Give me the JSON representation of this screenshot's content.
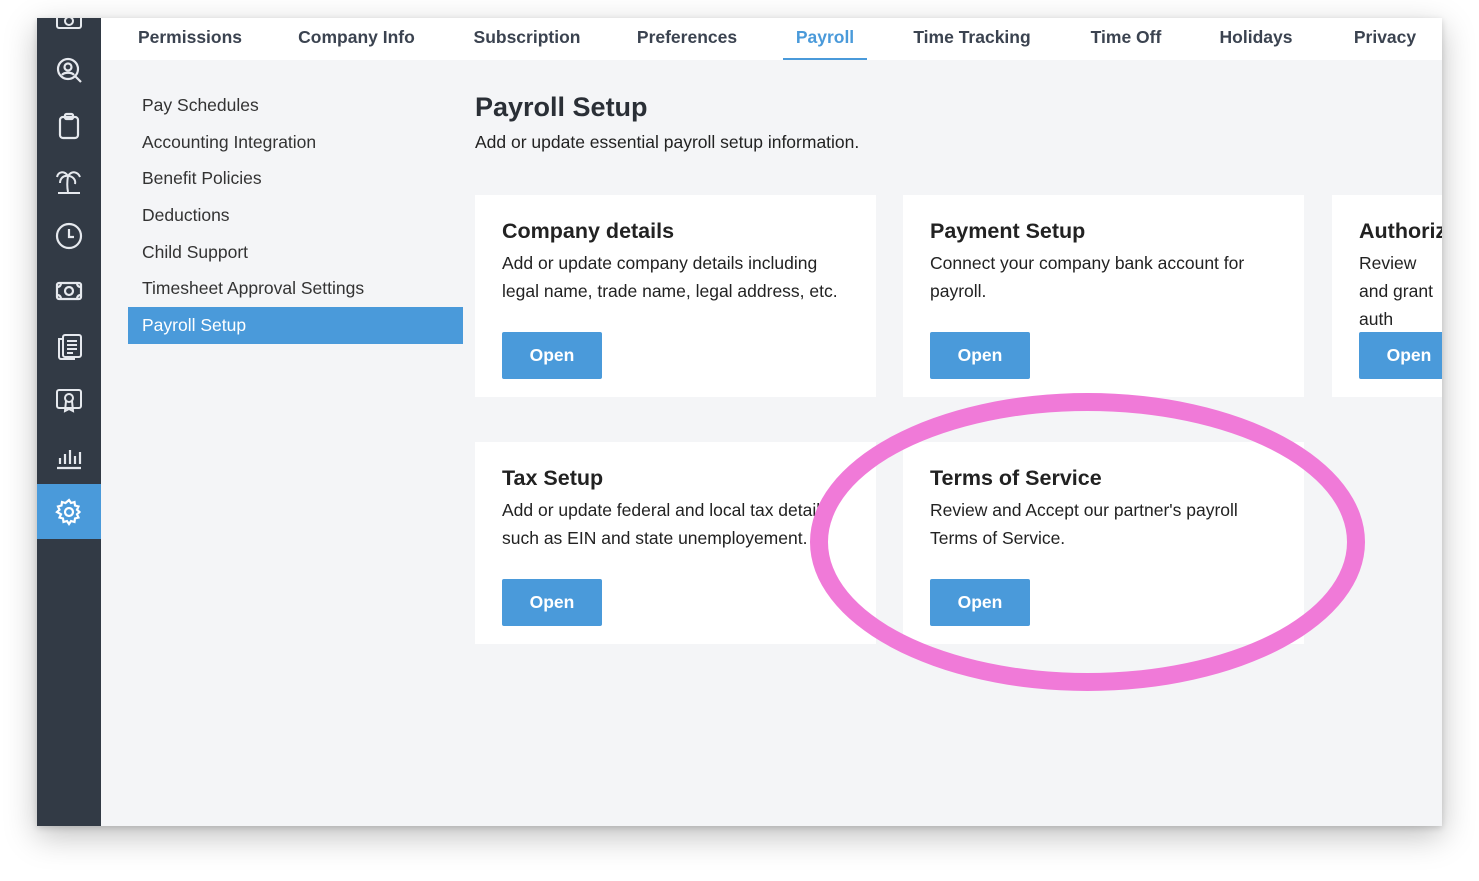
{
  "colors": {
    "accent": "#4a9ada",
    "rail": "#323a45",
    "highlight": "#f07ad8"
  },
  "rail": {
    "icons": [
      "money-icon",
      "user-search-icon",
      "clipboard-icon",
      "palm-tree-icon",
      "clock-icon",
      "cash-icon",
      "documents-icon",
      "certificate-icon",
      "bar-chart-icon",
      "gear-icon"
    ],
    "active": "gear-icon"
  },
  "tabs": [
    {
      "label": "Permissions"
    },
    {
      "label": "Company Info"
    },
    {
      "label": "Subscription"
    },
    {
      "label": "Preferences"
    },
    {
      "label": "Payroll",
      "active": true
    },
    {
      "label": "Time Tracking"
    },
    {
      "label": "Time Off"
    },
    {
      "label": "Holidays"
    },
    {
      "label": "Privacy"
    }
  ],
  "subnav": [
    {
      "label": "Pay Schedules"
    },
    {
      "label": "Accounting Integration"
    },
    {
      "label": "Benefit Policies"
    },
    {
      "label": "Deductions"
    },
    {
      "label": "Child Support"
    },
    {
      "label": "Timesheet Approval Settings"
    },
    {
      "label": "Payroll Setup",
      "active": true
    }
  ],
  "page": {
    "title": "Payroll Setup",
    "subtitle": "Add or update essential payroll setup information."
  },
  "cards": [
    {
      "title": "Company details",
      "desc": "Add or update company details including legal name, trade name, legal address, etc.",
      "button": "Open"
    },
    {
      "title": "Payment Setup",
      "desc": "Connect your company bank account for payroll.",
      "button": "Open"
    },
    {
      "title": "Authoriz",
      "desc": "Review and grant auth",
      "button": "Open"
    },
    {
      "title": "Tax Setup",
      "desc": "Add or update federal and local tax details such as EIN and state unemployement.",
      "button": "Open"
    },
    {
      "title": "Terms of Service",
      "desc": "Review and Accept our partner's payroll Terms of Service.",
      "button": "Open"
    }
  ]
}
